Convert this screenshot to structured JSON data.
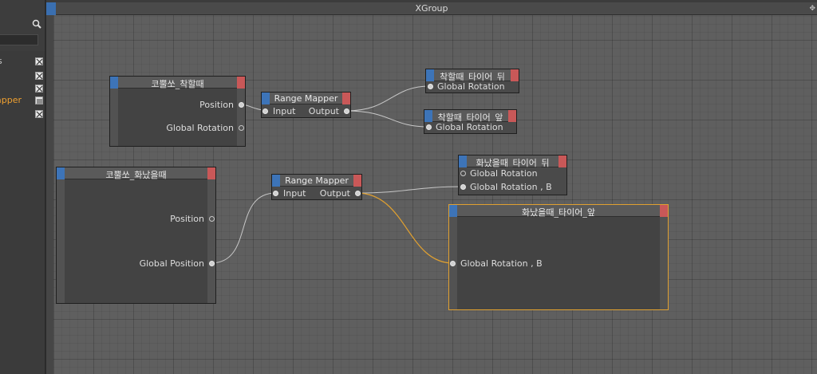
{
  "window": {
    "title": "XGroup",
    "drag_icon": "✥"
  },
  "left_panel": {
    "items": [
      {
        "label": "s",
        "active": false,
        "check_icon": "checked-box-icon"
      },
      {
        "label": "",
        "active": false,
        "check_icon": "checked-box-icon"
      },
      {
        "label": "",
        "active": false,
        "check_icon": "checked-box-icon"
      },
      {
        "label": "apper",
        "active": true,
        "check_icon": "list-box-icon"
      },
      {
        "label": "",
        "active": false,
        "check_icon": "checked-box-icon"
      }
    ]
  },
  "nodes": {
    "n1": {
      "title": "코뿔쏘_착할때",
      "ports": {
        "position": "Position",
        "global_rotation": "Global Rotation"
      }
    },
    "rm1": {
      "title": "Range Mapper",
      "input": "Input",
      "output": "Output"
    },
    "t1": {
      "title": "착할때_타이어_뒤",
      "port": "Global Rotation"
    },
    "t2": {
      "title": "착할때_타이어_앞",
      "port": "Global Rotation"
    },
    "n2": {
      "title": "코뿔쏘_화났을때",
      "ports": {
        "position": "Position",
        "global_position": "Global Position"
      }
    },
    "rm2": {
      "title": "Range Mapper",
      "input": "Input",
      "output": "Output"
    },
    "t3": {
      "title": "화났을때_타이어_뒤",
      "port_a": "Global Rotation",
      "port_b": "Global Rotation , B"
    },
    "t4": {
      "title": "화났을때_타이어_앞",
      "port": "Global Rotation , B"
    }
  },
  "colors": {
    "node_blue": "#3d74b8",
    "node_red": "#c95858",
    "wire": "#c8c8c8",
    "selected_wire": "#e0a030"
  }
}
